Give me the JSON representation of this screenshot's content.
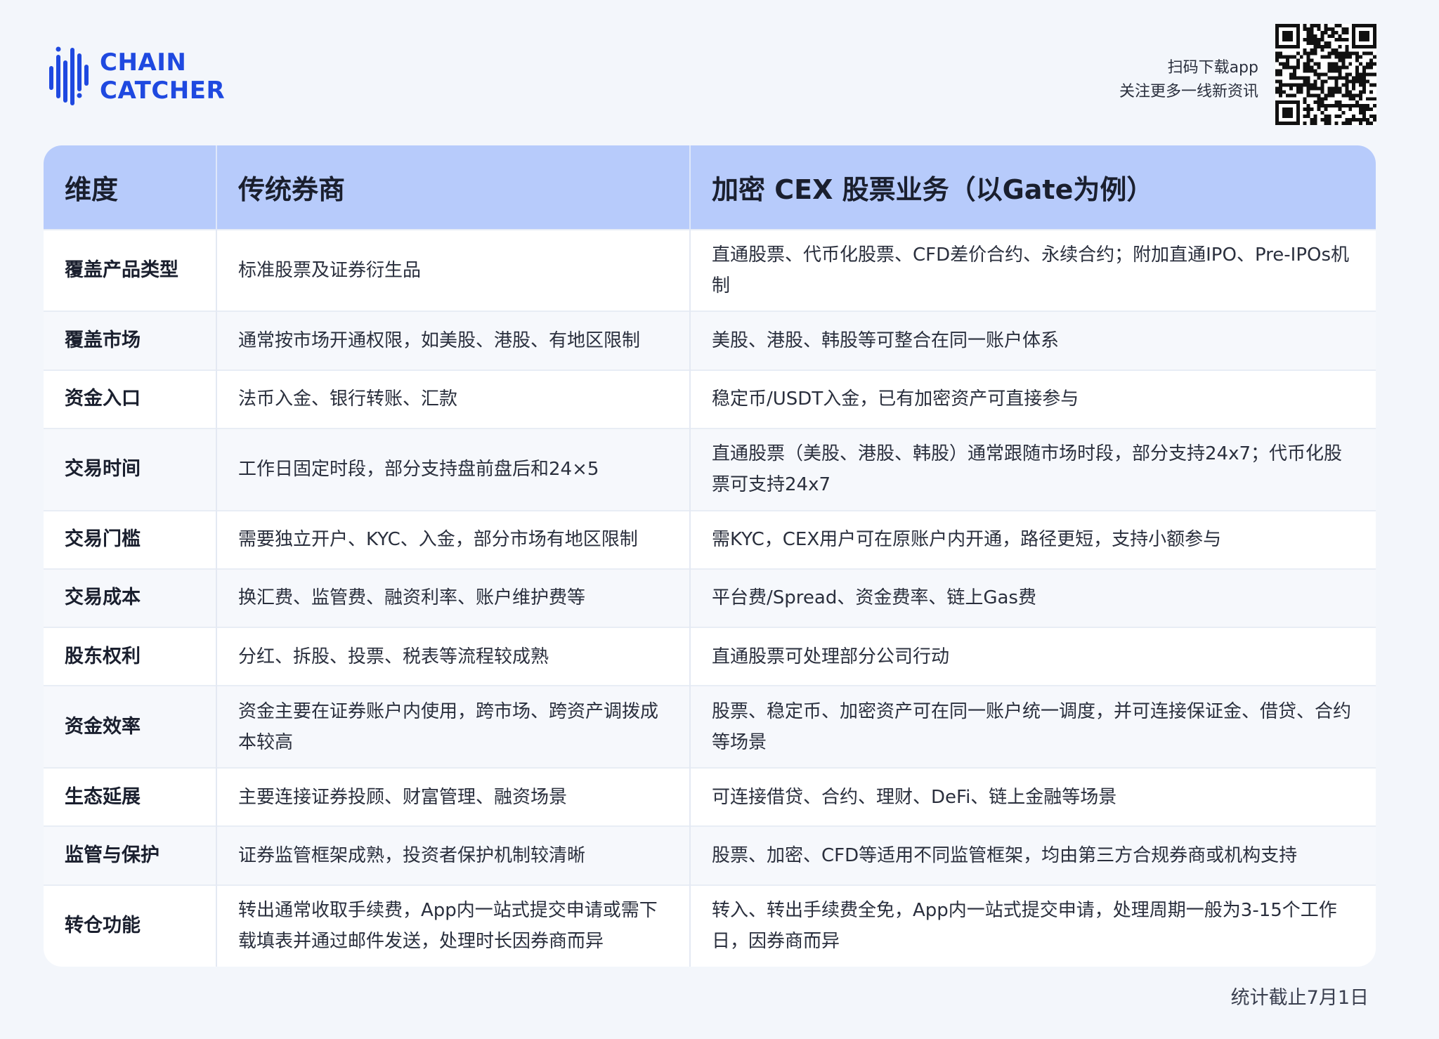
{
  "brand": {
    "line1": "CHAIN",
    "line2": "CATCHER",
    "color": "#1f49e0"
  },
  "promo": {
    "line1": "扫码下载app",
    "line2": "关注更多一线新资讯"
  },
  "qr_icon": "qr-code",
  "table": {
    "headers": [
      "维度",
      "传统券商",
      "加密 CEX 股票业务（以Gate为例）"
    ],
    "header_color": "#b7cbfb",
    "rows": [
      {
        "dim": "覆盖产品类型",
        "traditional": "标准股票及证券衍生品",
        "cex": "直通股票、代币化股票、CFD差价合约、永续合约；附加直通IPO、Pre-IPOs机制"
      },
      {
        "dim": "覆盖市场",
        "traditional": "通常按市场开通权限，如美股、港股、有地区限制",
        "cex": "美股、港股、韩股等可整合在同一账户体系"
      },
      {
        "dim": "资金入口",
        "traditional": "法币入金、银行转账、汇款",
        "cex": "稳定币/USDT入金，已有加密资产可直接参与"
      },
      {
        "dim": "交易时间",
        "traditional": "工作日固定时段，部分支持盘前盘后和24×5",
        "cex": "直通股票（美股、港股、韩股）通常跟随市场时段，部分支持24x7；代币化股票可支持24x7"
      },
      {
        "dim": "交易门槛",
        "traditional": "需要独立开户、KYC、入金，部分市场有地区限制",
        "cex": "需KYC，CEX用户可在原账户内开通，路径更短，支持小额参与"
      },
      {
        "dim": "交易成本",
        "traditional": "换汇费、监管费、融资利率、账户维护费等",
        "cex": "平台费/Spread、资金费率、链上Gas费"
      },
      {
        "dim": "股东权利",
        "traditional": "分红、拆股、投票、税表等流程较成熟",
        "cex": "直通股票可处理部分公司行动"
      },
      {
        "dim": "资金效率",
        "traditional": "资金主要在证券账户内使用，跨市场、跨资产调拨成本较高",
        "cex": "股票、稳定币、加密资产可在同一账户统一调度，并可连接保证金、借贷、合约等场景"
      },
      {
        "dim": "生态延展",
        "traditional": "主要连接证券投顾、财富管理、融资场景",
        "cex": "可连接借贷、合约、理财、DeFi、链上金融等场景"
      },
      {
        "dim": "监管与保护",
        "traditional": "证券监管框架成熟，投资者保护机制较清晰",
        "cex": "股票、加密、CFD等适用不同监管框架，均由第三方合规券商或机构支持"
      },
      {
        "dim": "转仓功能",
        "traditional": "转出通常收取手续费，App内一站式提交申请或需下载填表并通过邮件发送，处理时长因券商而异",
        "cex": "转入、转出手续费全免，App内一站式提交申请，处理周期一般为3-15个工作日，因券商而异"
      }
    ]
  },
  "footer_note": "统计截止7月1日"
}
